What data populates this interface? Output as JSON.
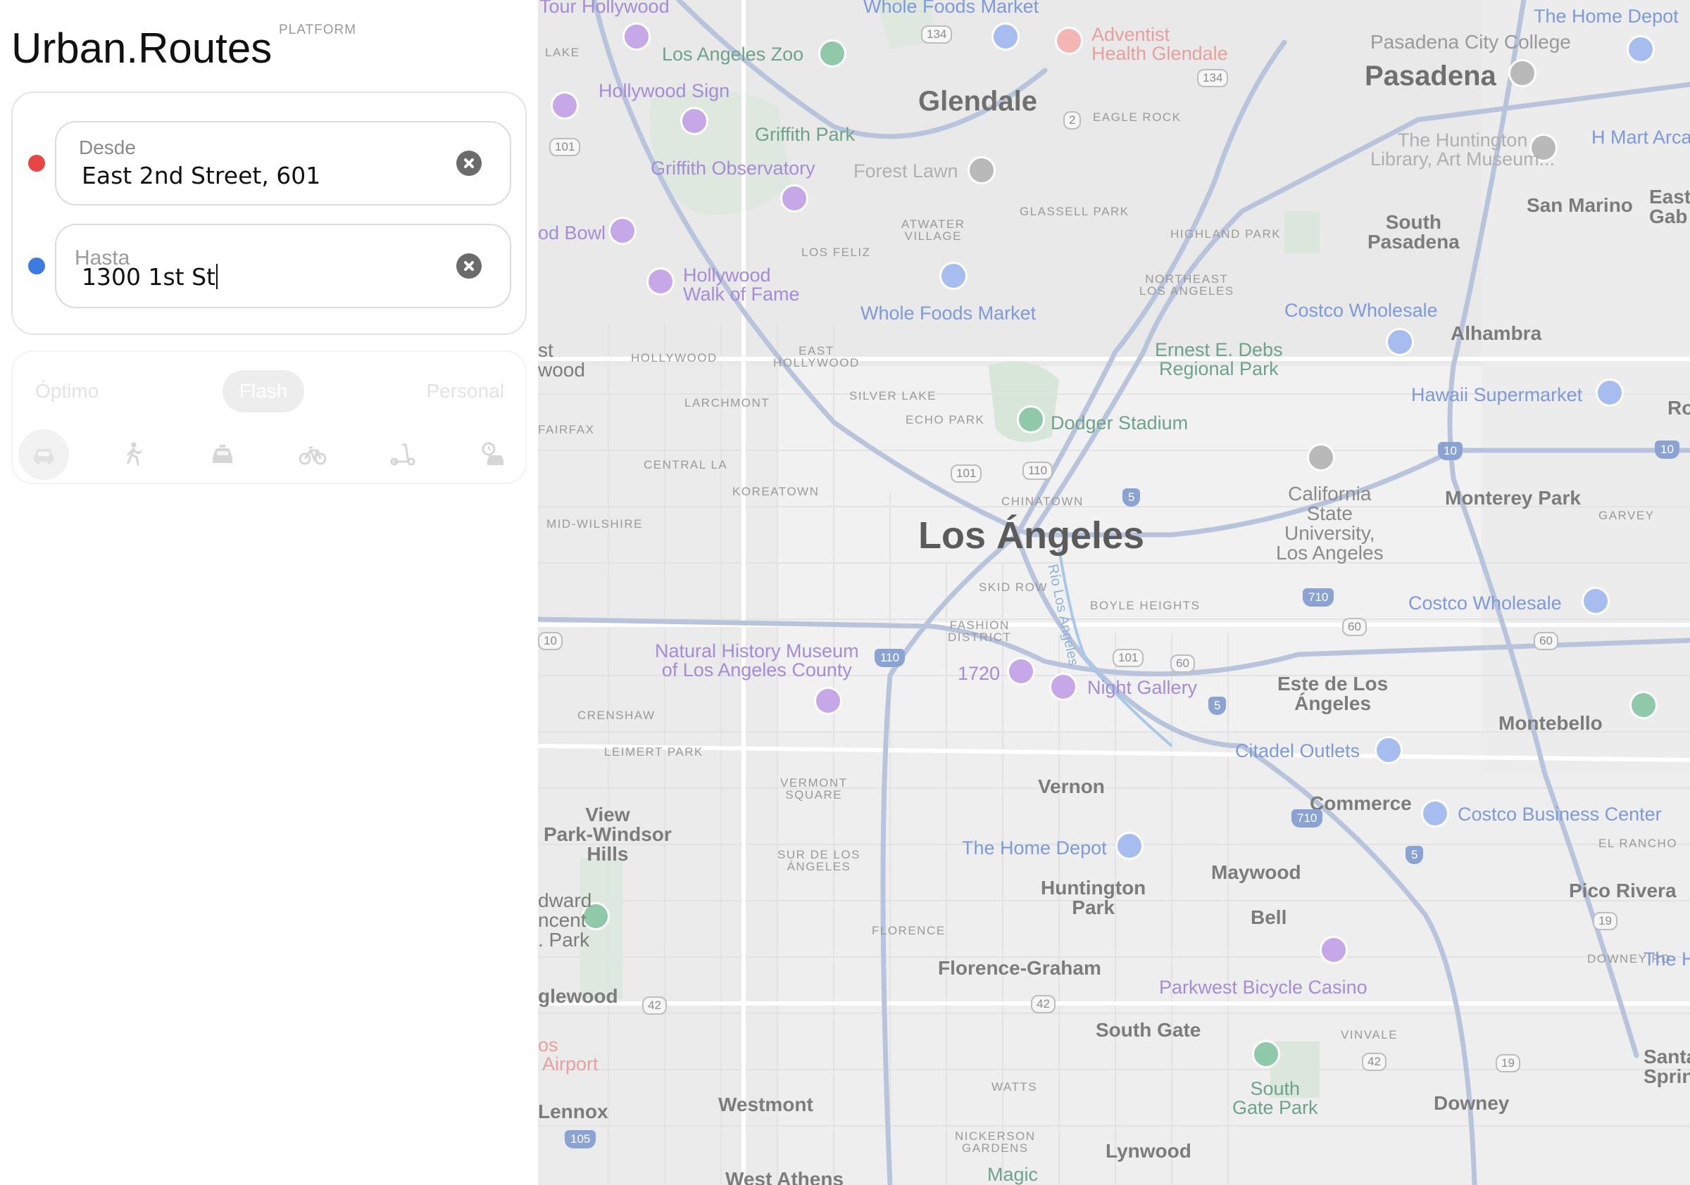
{
  "app": {
    "logo_part1": "Urban",
    "logo_dot": ".",
    "logo_part2": "Routes",
    "platform_label": "PLATFORM"
  },
  "route": {
    "from": {
      "label": "Desde",
      "value": "East 2nd Street, 601",
      "marker_color": "#e84545"
    },
    "to": {
      "label": "Hasta",
      "value": "1300 1st St",
      "marker_color": "#3d7be0"
    }
  },
  "modes": {
    "tabs": [
      {
        "label": "Óptimo"
      },
      {
        "label": "Flash"
      },
      {
        "label": "Personal"
      }
    ],
    "vehicles": [
      {
        "icon": "car-icon"
      },
      {
        "icon": "walk-icon"
      },
      {
        "icon": "taxi-icon"
      },
      {
        "icon": "bike-icon"
      },
      {
        "icon": "scooter-icon"
      },
      {
        "icon": "drive-clock-icon"
      }
    ]
  },
  "map": {
    "labels": {
      "los_angeles": "Los Ángeles",
      "glendale": "Glendale",
      "pasadena": "Pasadena",
      "pasadena_city_college": "Pasadena City College",
      "the_home_depot_top": "The Home Depot",
      "h_mart": "H Mart Arca",
      "san_marino": "San Marino",
      "east_gab": "East\nGab",
      "south_pasadena": "South\nPasadena",
      "alhambra": "Alhambra",
      "monterey_park": "Monterey Park",
      "garvey": "GARVEY",
      "hawaii_supermarket": "Hawaii Supermarket",
      "ro": "Ro",
      "cal_state": "California\nState\nUniversity,\nLos Angeles",
      "costco_1": "Costco Wholesale",
      "costco_2": "Costco Wholesale",
      "este_de_los_angeles": "Este de Los\nÁngeles",
      "montebello": "Montebello",
      "citadel": "Citadel Outlets",
      "commerce": "Commerce",
      "costco_business": "Costco Business Center",
      "el_rancho": "EL RANCHO",
      "pico_rivera": "Pico Rivera",
      "maywood": "Maywood",
      "bell": "Bell",
      "vernon": "Vernon",
      "home_depot_2": "The Home Depot",
      "huntington_park": "Huntington\nPark",
      "florence": "FLORENCE",
      "florence_graham": "Florence-Graham",
      "parkwest": "Parkwest Bicycle Casino",
      "south_gate": "South Gate",
      "vinvale": "VINVALE",
      "south_gate_park": "South\nGate Park",
      "downey": "Downey",
      "downey_rd": "DOWNEY RD",
      "the_h": "The H",
      "santa_fe": "Santa F\nSpring",
      "lynwood": "Lynwood",
      "watts": "WATTS",
      "nickerson": "NICKERSON\nGARDENS",
      "magic": "Magic",
      "westmont": "Westmont",
      "west_athens": "West Athens",
      "lennox": "Lennox",
      "airport": "os\n Airport",
      "inglewood": "glewood",
      "edward": "dward\nncent\n. Park",
      "view_park": "View\nPark-Windsor\nHills",
      "sur_de_los_angeles": "SUR DE LOS\nÁNGELES",
      "vermont_square": "VERMONT\nSQUARE",
      "leimert_park": "LEIMERT PARK",
      "crenshaw": "CRENSHAW",
      "nhm": "Natural History Museum\nof Los Angeles County",
      "fashion": "FASHION\nDISTRICT",
      "skid_row": "SKID ROW",
      "boyle_heights": "BOYLE HEIGHTS",
      "rio": "Río Los Ángeles",
      "l1720": "1720",
      "night_gallery": "Night Gallery",
      "chinatown": "CHINATOWN",
      "koreatown": "KOREATOWN",
      "mid_wilshire": "MID-WILSHIRE",
      "central_la": "CENTRAL LA",
      "fairfax": "FAIRFAX",
      "larchmont": "LARCHMONT",
      "hollywood_nb": "HOLLYWOOD",
      "east_hollywood": "EAST\nHOLLYWOOD",
      "silver_lake": "SILVER LAKE",
      "echo_park": "ECHO PARK",
      "dodger": "Dodger Stadium",
      "ernest": "Ernest E. Debs\nRegional Park",
      "costco_wholesale_3": "Costco Wholesale",
      "northeast_la": "NORTHEAST\nLOS ANGELES",
      "highland_park": "HIGHLAND PARK",
      "glassell_park": "GLASSELL PARK",
      "atwater": "ATWATER\nVILLAGE",
      "los_feliz": "LOS FELIZ",
      "whole_foods_1": "Whole Foods Market",
      "whole_foods_2": "Whole Foods Market",
      "hollywood_walk": "Hollywood\nWalk of Fame",
      "hollywood_bowl": "od Bowl",
      "griffith_obs": "Griffith Observatory",
      "griffith_park": "Griffith Park",
      "forest_lawn": "Forest Lawn",
      "hollywood_sign": "Hollywood Sign",
      "la_zoo": "Los Angeles Zoo",
      "lake": "LAKE",
      "tour_hollywood": "Tour Hollywood",
      "adventist": "Adventist\nHealth Glendale",
      "eagle_rock": "EAGLE ROCK",
      "huntington_lib": "The Huntington\nLibrary, Art Museum...",
      "st_wood": "st\nwood"
    },
    "shields": {
      "s134a": "134",
      "s134b": "134",
      "s2": "2",
      "s101a": "101",
      "s101b": "101",
      "s110": "110",
      "s5a": "5",
      "s10a": "10",
      "s10b": "10",
      "s710a": "710",
      "s710b": "710",
      "s60a": "60",
      "s60b": "60",
      "s60c": "60",
      "s101c": "101",
      "s110b": "110",
      "s5b": "5",
      "s5c": "5",
      "s42a": "42",
      "s42b": "42",
      "s42c": "42",
      "s19a": "19",
      "s19b": "19",
      "s105": "105",
      "s10c": "10"
    }
  }
}
